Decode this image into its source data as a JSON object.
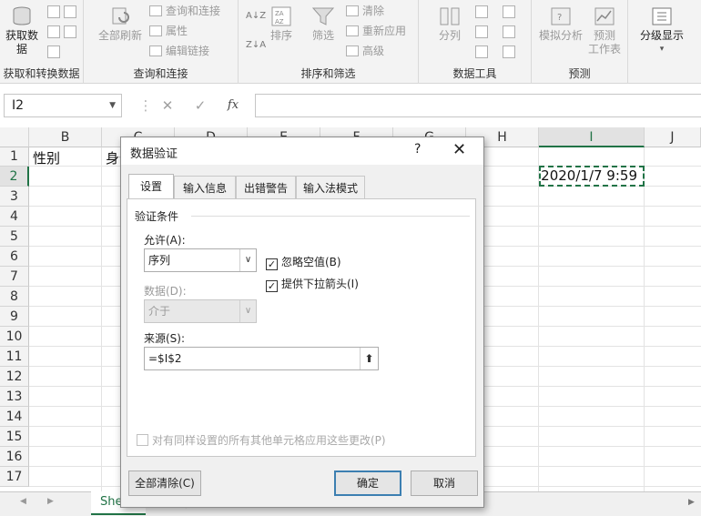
{
  "ribbon": {
    "groups": [
      {
        "label": "获取和转换数据",
        "big": "获取数\n据"
      },
      {
        "label": "查询和连接",
        "big": "全部刷新",
        "items": [
          "查询和连接",
          "属性",
          "编辑链接"
        ]
      },
      {
        "label": "排序和筛选",
        "sort": "排序",
        "filter": "筛选",
        "items": [
          "清除",
          "重新应用",
          "高级"
        ]
      },
      {
        "label": "数据工具",
        "big": "分列"
      },
      {
        "label": "预测",
        "whatif": "模拟分析",
        "forecast": "预测\n工作表"
      },
      {
        "label": "",
        "big": "分级显示"
      }
    ],
    "sort_icons": {
      "az": "A↓Z",
      "za": "Z↓A",
      "grid": "ZA AZ"
    }
  },
  "formula_bar": {
    "name_box": "I2",
    "cancel": "✕",
    "confirm": "✓",
    "fx": "fx",
    "content": ""
  },
  "sheet": {
    "columns": [
      "B",
      "C",
      "D",
      "E",
      "F",
      "G",
      "H",
      "I",
      "J"
    ],
    "rows": [
      "1",
      "2",
      "3",
      "4",
      "5",
      "6",
      "7",
      "8",
      "9",
      "10",
      "11",
      "12",
      "13",
      "14",
      "15",
      "16",
      "17"
    ],
    "cells": {
      "B1": "性别",
      "C1": "身份",
      "I2": "2020/1/7 9:59"
    },
    "tab_name": "She",
    "add_sheet": "⊕"
  },
  "dialog": {
    "title": "数据验证",
    "help": "?",
    "close": "✕",
    "tabs": [
      "设置",
      "输入信息",
      "出错警告",
      "输入法模式"
    ],
    "active_tab": 0,
    "section": "验证条件",
    "allow_label": "允许(A):",
    "allow_value": "序列",
    "data_label": "数据(D):",
    "data_value": "介于",
    "ignore_blank": "忽略空值(B)",
    "ignore_blank_checked": true,
    "dropdown_arrow": "提供下拉箭头(I)",
    "dropdown_arrow_checked": true,
    "source_label": "来源(S):",
    "source_value": "=$I$2",
    "apply_all": "对有同样设置的所有其他单元格应用这些更改(P)",
    "apply_all_checked": false,
    "clear_all": "全部清除(C)",
    "ok": "确定",
    "cancel": "取消"
  }
}
